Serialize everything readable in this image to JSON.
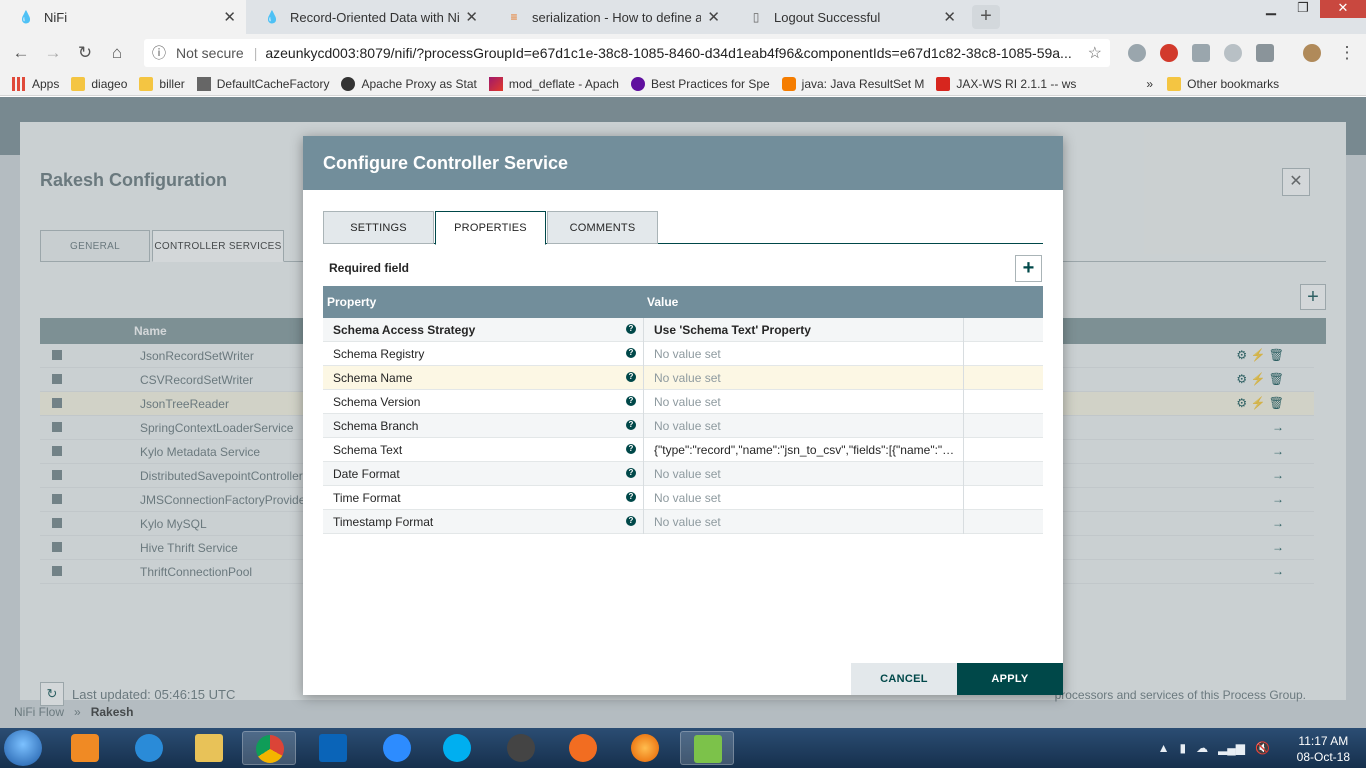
{
  "browser": {
    "tabs": [
      {
        "title": "NiFi",
        "icon": "nifi-icon",
        "active": true
      },
      {
        "title": "Record-Oriented Data with NiFi ",
        "icon": "nifi-icon",
        "active": false
      },
      {
        "title": "serialization - How to define avro",
        "icon": "stackoverflow-icon",
        "active": false
      },
      {
        "title": "Logout Successful",
        "icon": "page-icon",
        "active": false
      }
    ],
    "security_label": "Not secure",
    "url": "azeunkycd003:8079/nifi/?processGroupId=e67d1c1e-38c8-1085-8460-d34d1eab4f96&componentIds=e67d1c82-38c8-1085-59a...",
    "bookmarks": [
      {
        "label": "Apps",
        "icon": "apps-grid-icon"
      },
      {
        "label": "diageo",
        "icon": "folder-icon"
      },
      {
        "label": "biller",
        "icon": "folder-icon"
      },
      {
        "label": "DefaultCacheFactory",
        "icon": "jboss-icon"
      },
      {
        "label": "Apache Proxy as Stat",
        "icon": "apache-icon"
      },
      {
        "label": "mod_deflate - Apach",
        "icon": "apache-feather-icon"
      },
      {
        "label": "Best Practices for Spe",
        "icon": "yahoo-icon"
      },
      {
        "label": "java: Java ResultSet M",
        "icon": "blogger-icon"
      },
      {
        "label": "JAX-WS RI 2.1.1 -- ws",
        "icon": "oracle-icon"
      }
    ],
    "bookmarks_more": "»",
    "other_bookmarks": "Other bookmarks"
  },
  "background": {
    "title": "Rakesh Configuration",
    "tabs": [
      "GENERAL",
      "CONTROLLER SERVICES"
    ],
    "table_header": "Name",
    "rows": [
      {
        "name": "JsonRecordSetWriter",
        "action": "⚙ ⚡ 🗑"
      },
      {
        "name": "CSVRecordSetWriter",
        "action": "⚙ ⚡ 🗑"
      },
      {
        "name": "JsonTreeReader",
        "action": "⚙ ⚡ 🗑"
      },
      {
        "name": "SpringContextLoaderService",
        "action": "→"
      },
      {
        "name": "Kylo Metadata Service",
        "action": "→"
      },
      {
        "name": "DistributedSavepointController",
        "action": "→"
      },
      {
        "name": "JMSConnectionFactoryProvide",
        "action": "→"
      },
      {
        "name": "Kylo MySQL",
        "action": "→"
      },
      {
        "name": "Hive Thrift Service",
        "action": "→"
      },
      {
        "name": "ThriftConnectionPool",
        "action": "→"
      }
    ],
    "last_updated": "Last updated: 05:46:15 UTC",
    "footer_note": "processors and services of this Process Group.",
    "breadcrumb_root": "NiFi Flow",
    "breadcrumb_sep": "»",
    "breadcrumb_current": "Rakesh"
  },
  "dialog": {
    "title": "Configure Controller Service",
    "tabs": [
      {
        "label": "SETTINGS",
        "active": false
      },
      {
        "label": "PROPERTIES",
        "active": true
      },
      {
        "label": "COMMENTS",
        "active": false
      }
    ],
    "required_field": "Required field",
    "col_property": "Property",
    "col_value": "Value",
    "properties": [
      {
        "name": "Schema Access Strategy",
        "value": "Use 'Schema Text' Property",
        "required": true,
        "unset": false
      },
      {
        "name": "Schema Registry",
        "value": "No value set",
        "required": false,
        "unset": true
      },
      {
        "name": "Schema Name",
        "value": "No value set",
        "required": false,
        "unset": true
      },
      {
        "name": "Schema Version",
        "value": "No value set",
        "required": false,
        "unset": true
      },
      {
        "name": "Schema Branch",
        "value": "No value set",
        "required": false,
        "unset": true
      },
      {
        "name": "Schema Text",
        "value": "{\"type\":\"record\",\"name\":\"jsn_to_csv\",\"fields\":[{\"name\":\"stor...",
        "required": false,
        "unset": false
      },
      {
        "name": "Date Format",
        "value": "No value set",
        "required": false,
        "unset": true
      },
      {
        "name": "Time Format",
        "value": "No value set",
        "required": false,
        "unset": true
      },
      {
        "name": "Timestamp Format",
        "value": "No value set",
        "required": false,
        "unset": true
      }
    ],
    "cancel": "CANCEL",
    "apply": "APPLY"
  },
  "taskbar": {
    "time": "11:17 AM",
    "date": "08-Oct-18"
  }
}
